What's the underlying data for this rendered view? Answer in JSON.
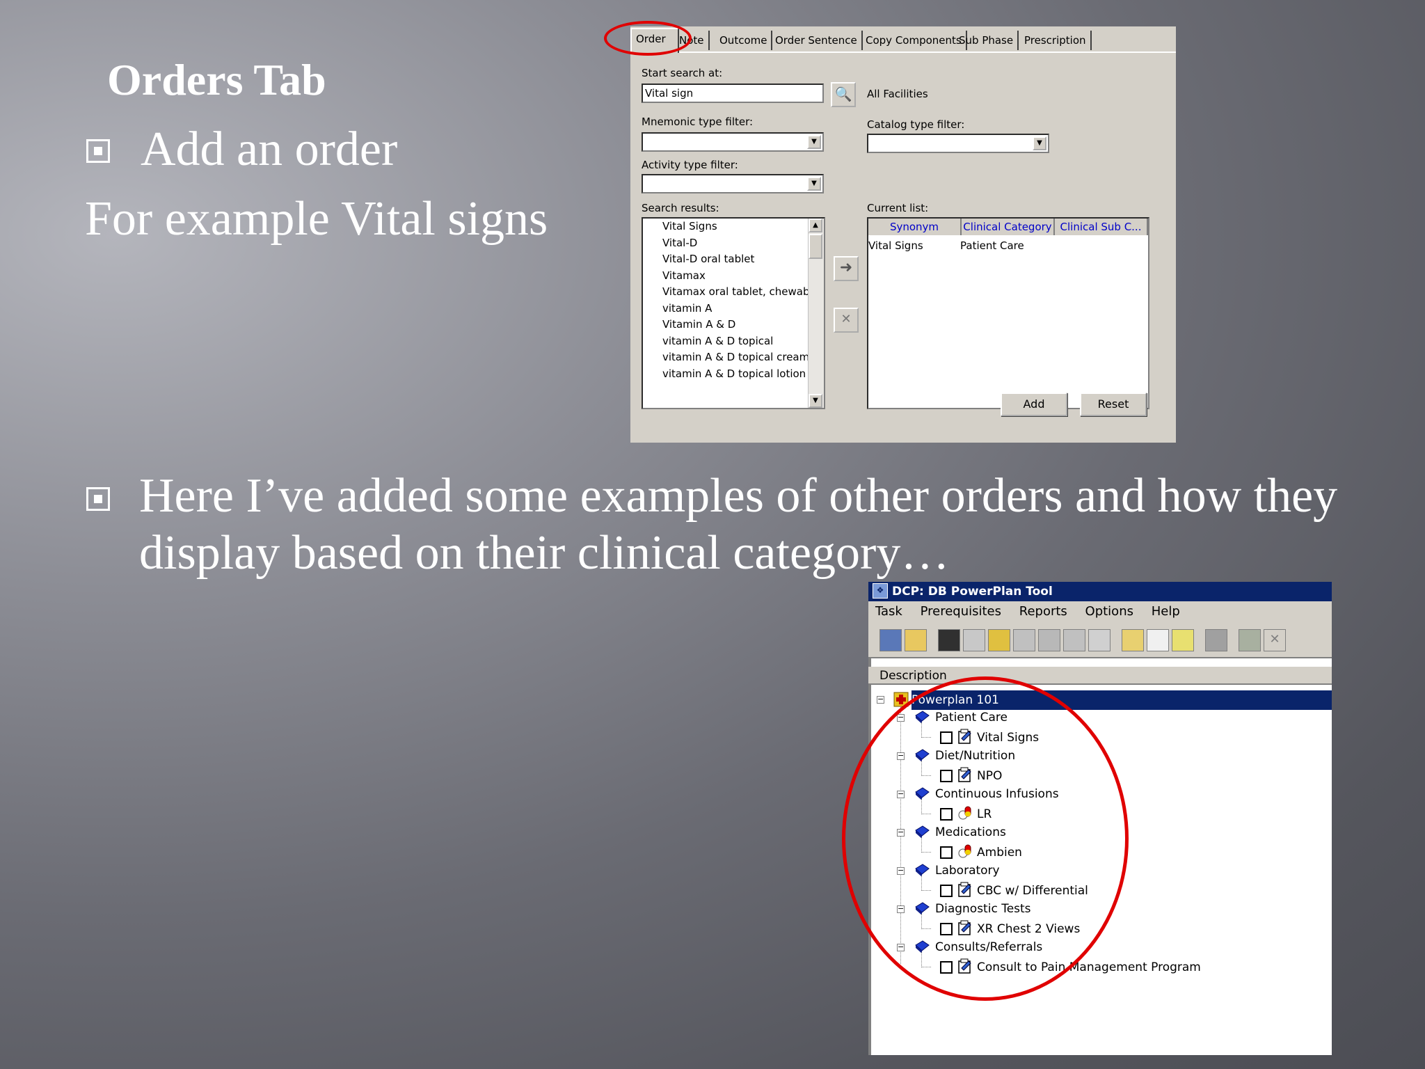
{
  "slide": {
    "title": "Orders Tab",
    "bullet1": "Add  an order",
    "example": "For example Vital signs",
    "bullet2": "Here I’ve added some examples of other orders and how they display based on their clinical category…"
  },
  "orders_dialog": {
    "tabs": [
      "Order",
      "Note",
      "Outcome",
      "Order Sentence",
      "Copy Components",
      "Sub Phase",
      "Prescription"
    ],
    "start_search_label": "Start search at:",
    "start_search_value": "Vital sign",
    "facilities_label": "All Facilities",
    "mnemonic_filter_label": "Mnemonic type filter:",
    "catalog_filter_label": "Catalog type filter:",
    "activity_filter_label": "Activity type filter:",
    "search_results_label": "Search results:",
    "current_list_label": "Current list:",
    "search_results": [
      "Vital Signs",
      "Vital-D",
      "Vital-D oral tablet",
      "Vitamax",
      "Vitamax oral tablet, chewable",
      "vitamin A",
      "Vitamin A & D",
      "vitamin A & D topical",
      "vitamin A & D topical cream",
      "vitamin A & D topical lotion"
    ],
    "current_columns": [
      "Synonym",
      "Clinical Category",
      "Clinical Sub C..."
    ],
    "current_rows": [
      {
        "synonym": "Vital Signs",
        "category": "Patient Care"
      }
    ],
    "add_label": "Add",
    "reset_label": "Reset"
  },
  "powerplan": {
    "window_title": "DCP: DB PowerPlan Tool",
    "menu": [
      "Task",
      "Prerequisites",
      "Reports",
      "Options",
      "Help"
    ],
    "column_header": "Description",
    "root": "Powerplan 101",
    "categories": [
      {
        "name": "Patient Care",
        "order": "Vital Signs",
        "icon": "order-sheet-icon"
      },
      {
        "name": "Diet/Nutrition",
        "order": "NPO",
        "icon": "order-sheet-icon"
      },
      {
        "name": "Continuous Infusions",
        "order": "LR",
        "icon": "medication-icon"
      },
      {
        "name": "Medications",
        "order": "Ambien",
        "icon": "medication-icon"
      },
      {
        "name": "Laboratory",
        "order": "CBC w/ Differential",
        "icon": "order-sheet-icon"
      },
      {
        "name": "Diagnostic Tests",
        "order": "XR Chest 2 Views",
        "icon": "order-sheet-icon"
      },
      {
        "name": "Consults/Referrals",
        "order": "Consult to Pain Management Program",
        "icon": "order-sheet-icon"
      }
    ]
  },
  "colors": {
    "highlight_red": "#e00000",
    "title_bar": "#0a246a",
    "dialog_bg": "#d4d0c8"
  }
}
